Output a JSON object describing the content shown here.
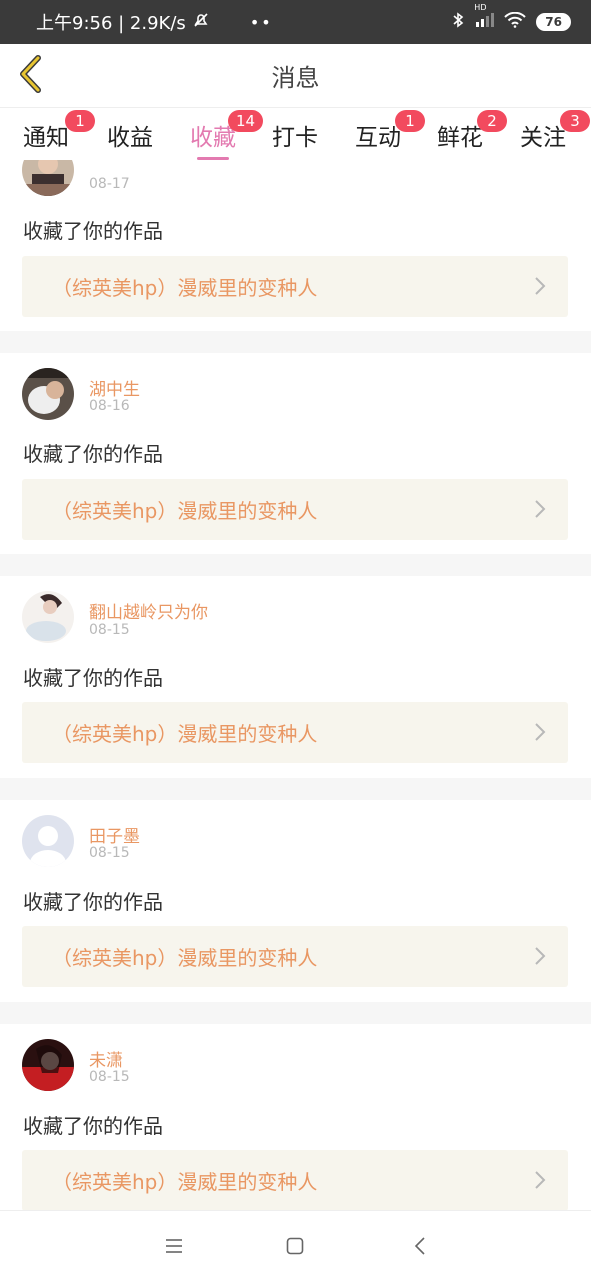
{
  "status_bar": {
    "time_speed": "上午9:56 | 2.9K/s",
    "dots": "••",
    "hd_label": "HD",
    "battery": "76"
  },
  "header": {
    "title": "消息"
  },
  "tabs": [
    {
      "label": "通知",
      "badge": "1"
    },
    {
      "label": "收益",
      "badge": ""
    },
    {
      "label": "收藏",
      "badge": "14",
      "active": true
    },
    {
      "label": "打卡",
      "badge": ""
    },
    {
      "label": "互动",
      "badge": "1"
    },
    {
      "label": "鲜花",
      "badge": "2"
    },
    {
      "label": "关注",
      "badge": "3"
    }
  ],
  "items": [
    {
      "username": "",
      "date": "08-17",
      "action": "收藏了你的作品",
      "work": "（综英美hp）漫威里的变种人"
    },
    {
      "username": "湖中生",
      "date": "08-16",
      "action": "收藏了你的作品",
      "work": "（综英美hp）漫威里的变种人"
    },
    {
      "username": "翻山越岭只为你",
      "date": "08-15",
      "action": "收藏了你的作品",
      "work": "（综英美hp）漫威里的变种人"
    },
    {
      "username": "田子墨",
      "date": "08-15",
      "action": "收藏了你的作品",
      "work": "（综英美hp）漫威里的变种人"
    },
    {
      "username": "未潇",
      "date": "08-15",
      "action": "收藏了你的作品",
      "work": "（综英美hp）漫威里的变种人"
    }
  ],
  "colors": {
    "accent_pink": "#e37ab0",
    "badge_red": "#f24a5e",
    "username_orange": "#e99763",
    "work_box_bg": "#f7f5ed",
    "back_arrow_yellow": "#e8c531"
  },
  "icons": {
    "back": "chevron-left-icon",
    "item_arrow": "chevron-right-icon",
    "nav_menu": "menu-icon",
    "nav_home": "square-icon",
    "nav_back": "back-triangle-icon"
  }
}
